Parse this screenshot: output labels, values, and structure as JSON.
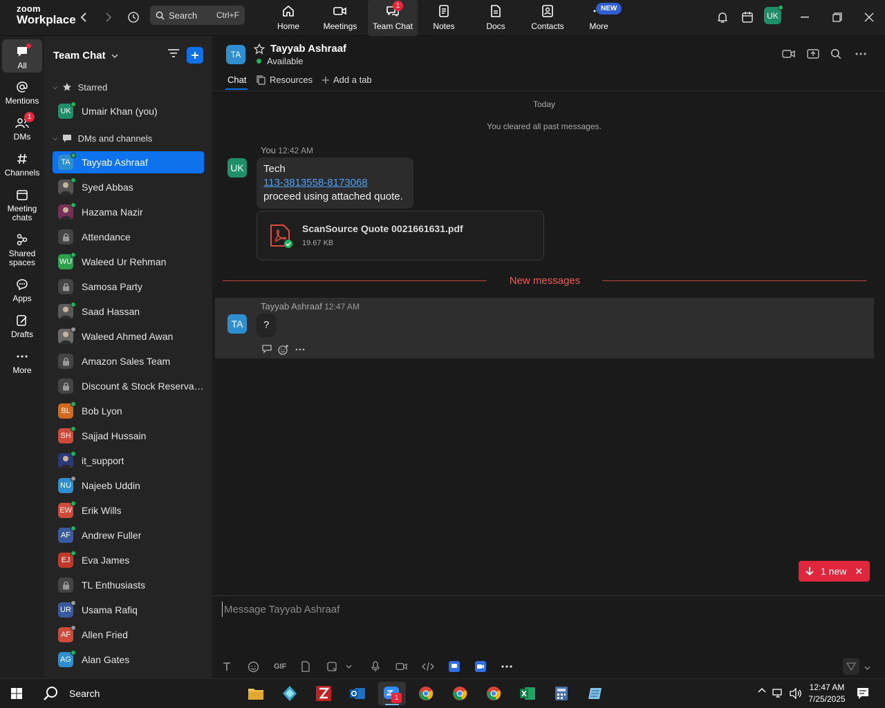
{
  "app": {
    "logo_line1": "zoom",
    "logo_line2": "Workplace"
  },
  "topbar": {
    "search_label": "Search",
    "search_shortcut": "Ctrl+F",
    "nav": [
      {
        "label": "Home",
        "icon": "home-icon"
      },
      {
        "label": "Meetings",
        "icon": "video-camera-icon"
      },
      {
        "label": "Team Chat",
        "icon": "chat-bubbles-icon",
        "badge": "1"
      },
      {
        "label": "Notes",
        "icon": "notes-icon"
      },
      {
        "label": "Docs",
        "icon": "docs-icon"
      },
      {
        "label": "Contacts",
        "icon": "contacts-icon"
      },
      {
        "label": "More",
        "icon": "more-dots-icon",
        "badge": "NEW"
      }
    ],
    "user_initials": "UK"
  },
  "rail": [
    {
      "label": "All",
      "icon": "chat-bubble-icon",
      "active": true
    },
    {
      "label": "Mentions",
      "icon": "at-sign-icon"
    },
    {
      "label": "DMs",
      "icon": "people-icon",
      "badge": "1"
    },
    {
      "label": "Channels",
      "icon": "hash-icon"
    },
    {
      "label": "Meeting chats",
      "icon": "calendar-icon"
    },
    {
      "label": "Shared spaces",
      "icon": "nodes-icon"
    },
    {
      "label": "Apps",
      "icon": "apps-bubble-icon"
    },
    {
      "label": "Drafts",
      "icon": "pencil-note-icon"
    },
    {
      "label": "More",
      "icon": "ellipsis-icon"
    }
  ],
  "sidebar": {
    "title": "Team Chat",
    "starred_header": "Starred",
    "dms_header": "DMs and channels",
    "starred": [
      {
        "name": "Umair Khan (you)",
        "initials": "UK",
        "color": "#1f8f6a",
        "status": "#1bb55c"
      }
    ],
    "items": [
      {
        "name": "Tayyab Ashraaf",
        "initials": "TA",
        "color": "#2f8fce",
        "status": "#1bb55c",
        "active": true
      },
      {
        "name": "Syed Abbas",
        "initials": "",
        "color": "#555555",
        "status": "#1bb55c",
        "photo": true
      },
      {
        "name": "Hazama Nazir",
        "initials": "",
        "color": "#7a2f5a",
        "status": "#1bb55c",
        "photo": true
      },
      {
        "name": "Attendance",
        "initials": "",
        "color": "#444444",
        "lock": true
      },
      {
        "name": "Waleed Ur Rehman",
        "initials": "WU",
        "color": "#2aa14a",
        "status": "#1bb55c"
      },
      {
        "name": "Samosa Party",
        "initials": "",
        "color": "#444444",
        "lock": true
      },
      {
        "name": "Saad Hassan",
        "initials": "",
        "color": "#5a5a5a",
        "status": "#1bb55c",
        "photo": true
      },
      {
        "name": "Waleed Ahmed Awan",
        "initials": "",
        "color": "#6a6a6a",
        "status": "#999999",
        "photo": true
      },
      {
        "name": "Amazon Sales Team",
        "initials": "",
        "color": "#444444",
        "lock": true
      },
      {
        "name": "Discount & Stock Reservati...",
        "initials": "",
        "color": "#444444",
        "lock": true
      },
      {
        "name": "Bob Lyon",
        "initials": "BL",
        "color": "#d2691e",
        "status": "#1bb55c"
      },
      {
        "name": "Sajjad Hussain",
        "initials": "SH",
        "color": "#d04a3a",
        "status": "#1bb55c"
      },
      {
        "name": "it_support",
        "initials": "",
        "color": "#2b3a78",
        "status": "#1bb55c",
        "photo": true
      },
      {
        "name": "Najeeb Uddin",
        "initials": "NU",
        "color": "#2f8fce",
        "status": "#999999"
      },
      {
        "name": "Erik Wills",
        "initials": "EW",
        "color": "#d04a3a",
        "status": "#1bb55c"
      },
      {
        "name": "Andrew Fuller",
        "initials": "AF",
        "color": "#3a5aa0",
        "status": "#1bb55c"
      },
      {
        "name": "Eva James",
        "initials": "EJ",
        "color": "#c0392b",
        "status": "#1bb55c"
      },
      {
        "name": "TL Enthusiasts",
        "initials": "",
        "color": "#444444",
        "lock": true
      },
      {
        "name": "Usama Rafiq",
        "initials": "UR",
        "color": "#3a5aa0",
        "status": "#999999"
      },
      {
        "name": "Allen Fried",
        "initials": "AF",
        "color": "#d04a3a",
        "status": "#999999"
      },
      {
        "name": "Alan Gates",
        "initials": "AG",
        "color": "#2f8fce",
        "status": "#1bb55c"
      }
    ]
  },
  "chat": {
    "contact_name": "Tayyab Ashraaf",
    "contact_initials": "TA",
    "contact_status": "Available",
    "tabs": [
      "Chat",
      "Resources",
      "Add a tab"
    ],
    "today_label": "Today",
    "cleared_label": "You cleared all past messages.",
    "messages": [
      {
        "sender": "You",
        "time": "12:42 AM",
        "initials": "UK",
        "line1": "Tech",
        "link": "113-3813558-8173068",
        "line3": "proceed using attached quote.",
        "file_name": "ScanSource Quote 0021661631.pdf",
        "file_size": "19.67 KB"
      },
      {
        "sender": "Tayyab Ashraaf",
        "time": "12:47 AM",
        "initials": "TA",
        "text": "?"
      }
    ],
    "new_messages_label": "New messages",
    "new_pill_label": "1 new",
    "composer_placeholder": "Message Tayyab Ashraaf",
    "gif_label": "GIF"
  },
  "taskbar": {
    "search_label": "Search",
    "time": "12:47 AM",
    "date": "7/25/2025",
    "zoom_badge": "1"
  },
  "colors": {
    "accent": "#0e72ed",
    "new_message": "#f05c55",
    "pill": "#e0263c",
    "online": "#1bb55c"
  }
}
